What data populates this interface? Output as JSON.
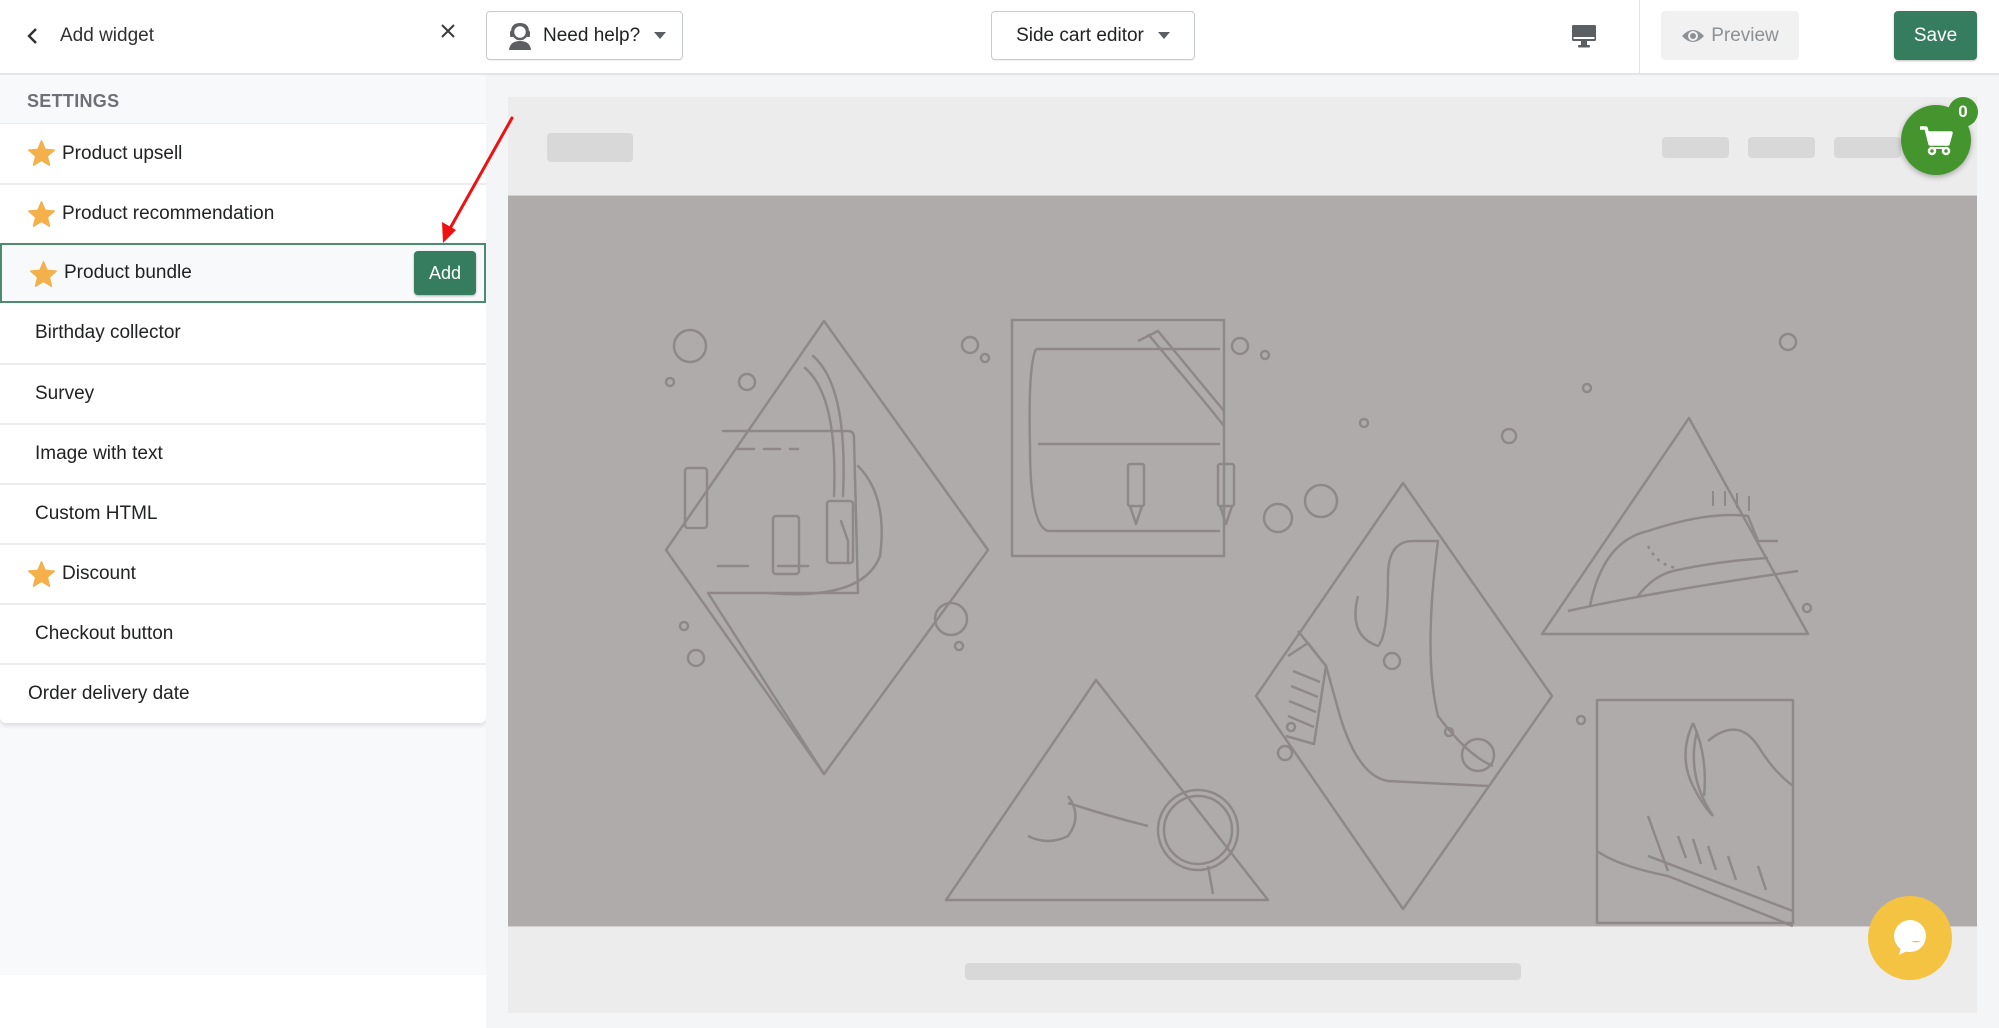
{
  "topbar": {
    "back_label": "Add widget",
    "help_label": "Need help?",
    "editor_label": "Side cart editor",
    "preview_label": "Preview",
    "save_label": "Save"
  },
  "sidebar": {
    "section_title": "SETTINGS",
    "add_label": "Add",
    "items": [
      {
        "label": "Product upsell",
        "starred": true
      },
      {
        "label": "Product recommendation",
        "starred": true
      },
      {
        "label": "Product bundle",
        "starred": true,
        "selected": true
      },
      {
        "label": "Birthday collector",
        "starred": false
      },
      {
        "label": "Survey",
        "starred": false
      },
      {
        "label": "Image with text",
        "starred": false
      },
      {
        "label": "Custom HTML",
        "starred": false
      },
      {
        "label": "Discount",
        "starred": true
      },
      {
        "label": "Checkout button",
        "starred": false
      },
      {
        "label": "Order delivery date",
        "starred": false
      }
    ]
  },
  "preview": {
    "cart_count": "0",
    "device": "desktop-icon",
    "icons": [
      "cart-icon",
      "chat-icon"
    ]
  },
  "colors": {
    "primary": "#367c5e",
    "selected_border": "#4e8a70",
    "star": "#f4b04b",
    "cart": "#45952f",
    "chat": "#f4c342",
    "annotation_arrow": "#ee1111"
  }
}
